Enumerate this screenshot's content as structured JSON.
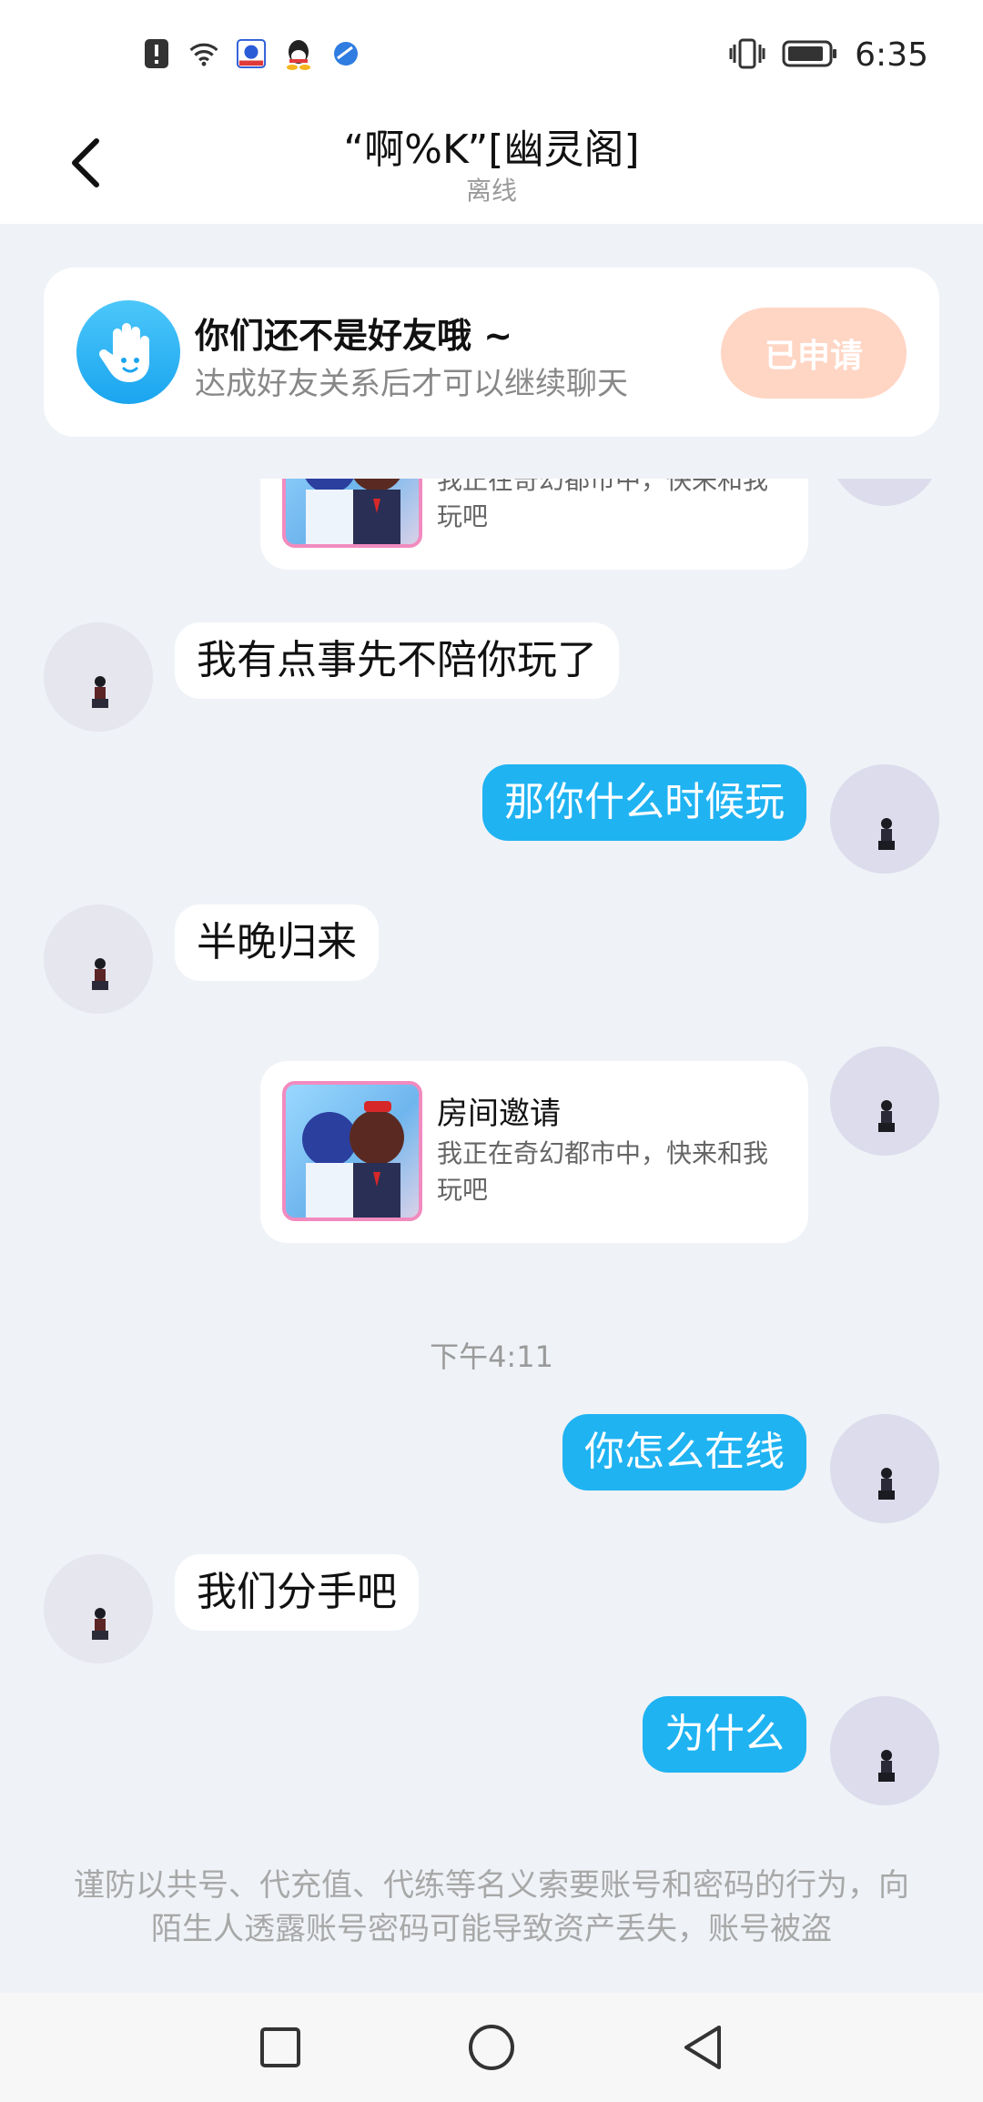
{
  "status_bar": {
    "time": "6:35",
    "left_icons": [
      "alert-icon",
      "wifi-icon",
      "baidu-icon",
      "qq-icon",
      "browser-icon"
    ],
    "right_icons": [
      "vibrate-icon",
      "battery-icon"
    ]
  },
  "header": {
    "title": "“啊%K”[幽灵阁]",
    "subtitle": "离线"
  },
  "friend_notice": {
    "title": "你们还不是好友哦 ~",
    "desc": "达成好友关系后才可以继续聊天",
    "button": "已申请"
  },
  "messages": {
    "invite_top_desc": "我正在奇幻都市中，快来和我玩吧",
    "m1": "我有点事先不陪你玩了",
    "m2": "那你什么时候玩",
    "m3": "半晚归来",
    "invite_title": "房间邀请",
    "invite_desc": "我正在奇幻都市中，快来和我玩吧",
    "time_divider": "下午4:11",
    "m4": "你怎么在线",
    "m5": "我们分手吧",
    "m6": "为什么"
  },
  "warning": "谨防以共号、代充值、代练等名义索要账号和密码的行为，向陌生人透露账号密码可能导致资产丢失，账号被盗",
  "colors": {
    "accent": "#1fb3f2",
    "applied_button": "#ffd5c4",
    "background": "#eff2f7"
  }
}
